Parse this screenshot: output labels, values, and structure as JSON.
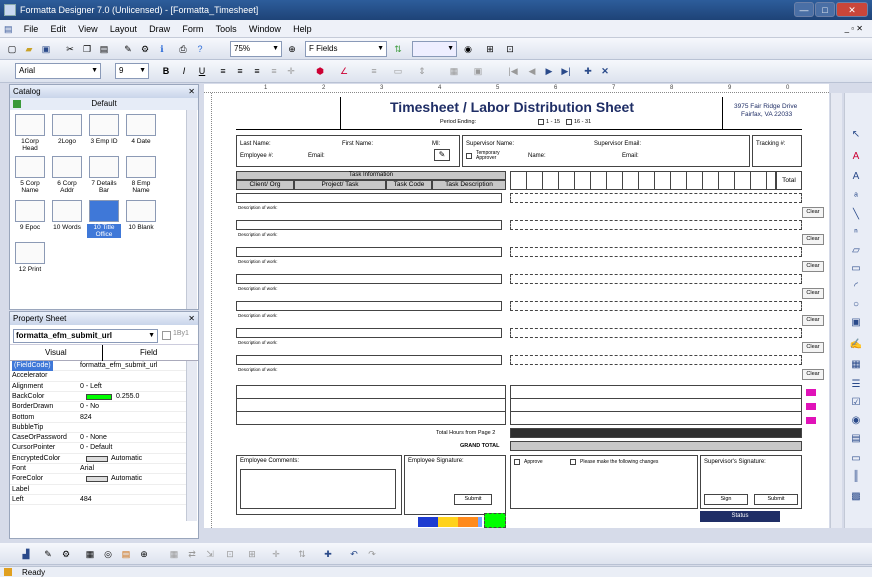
{
  "window": {
    "title": "Formatta Designer 7.0 (Unlicensed) - [Formatta_Timesheet]"
  },
  "menu": [
    "File",
    "Edit",
    "View",
    "Layout",
    "Draw",
    "Form",
    "Tools",
    "Window",
    "Help"
  ],
  "toolbar": {
    "zoom": "75%",
    "field_combo": "F Fields",
    "font": "Arial",
    "size": "9",
    "bold": "B",
    "italic": "I",
    "underline": "U"
  },
  "catalog": {
    "title": "Catalog",
    "tab": "Default",
    "items": [
      {
        "label": "1Corp Head"
      },
      {
        "label": "2Logo"
      },
      {
        "label": "3 Emp ID"
      },
      {
        "label": "4 Date"
      },
      {
        "label": "5 Corp Name"
      },
      {
        "label": "6 Corp Addr"
      },
      {
        "label": "7 Details Bar"
      },
      {
        "label": "8 Emp Name"
      },
      {
        "label": "9 Epoc"
      },
      {
        "label": "10 Words"
      },
      {
        "label": "10 Title Office"
      },
      {
        "label": "10 Blank"
      },
      {
        "label": "12 Print"
      }
    ]
  },
  "property_sheet": {
    "title": "Property Sheet",
    "selected": "formatta_efm_submit_url",
    "checkbox_label": "1By1",
    "tab_visual": "Visual",
    "tab_field": "Field",
    "rows": [
      {
        "k": "(FieldCode)",
        "v": "formatta_efm_submit_url"
      },
      {
        "k": "Accelerator",
        "v": ""
      },
      {
        "k": "Alignment",
        "v": "0 - Left"
      },
      {
        "k": "BackColor",
        "v": "0.255.0"
      },
      {
        "k": "BorderDrawn",
        "v": "0 - No"
      },
      {
        "k": "Bottom",
        "v": "824"
      },
      {
        "k": "BubbleTip",
        "v": ""
      },
      {
        "k": "CaseOrPassword",
        "v": "0 - None"
      },
      {
        "k": "CursorPointer",
        "v": "0 - Default"
      },
      {
        "k": "EncryptedColor",
        "v": "Automatic"
      },
      {
        "k": "Font",
        "v": "Arial"
      },
      {
        "k": "ForeColor",
        "v": "Automatic"
      },
      {
        "k": "Label",
        "v": ""
      },
      {
        "k": "Left",
        "v": "484"
      }
    ],
    "backcolor_swatch": "#00ff00"
  },
  "ruler": [
    "1",
    "2",
    "3",
    "4",
    "5",
    "6",
    "7",
    "8",
    "9",
    "0"
  ],
  "form": {
    "title": "Timesheet / Labor Distribution Sheet",
    "address1": "3975 Fair Ridge Drive",
    "address2": "Fairfax, VA 22033",
    "period": "Period Ending:",
    "p1": "1 - 15",
    "p2": "16 - 31",
    "last_name": "Last Name:",
    "first_name": "First Name:",
    "mi": "MI:",
    "employee_num": "Employee #:",
    "email": "Email:",
    "supervisor_name": "Supervisor Name:",
    "supervisor_email": "Supervisor Email:",
    "temporary": "Temporary Approver",
    "name": "Name:",
    "email2": "Email:",
    "tracking": "Tracking #:",
    "task_info": "Task Information",
    "col_client": "Client/ Org",
    "col_project": "Project/ Task",
    "col_code": "Task Code",
    "col_desc": "Task Description",
    "col_total": "Total",
    "desc_work": "Description of work:",
    "clear": "Clear",
    "hours_from_page2": "Total Hours from Page 2",
    "grand_total": "GRAND TOTAL",
    "emp_comments": "Employee Comments:",
    "emp_signature": "Employee Signature:",
    "submit": "Submit",
    "approve": "Approve",
    "please_change": "Please make the following changes",
    "sup_signature": "Supervisor's Signature:",
    "sign": "Sign",
    "submit2": "Submit",
    "status": "Status"
  },
  "statusbar": {
    "text": "Ready"
  }
}
